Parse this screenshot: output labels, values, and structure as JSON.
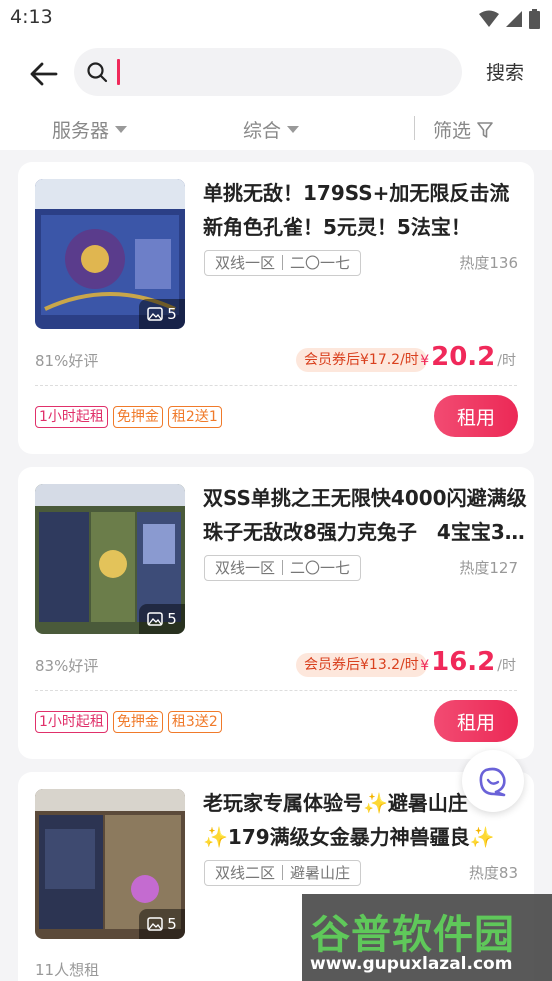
{
  "status": {
    "time": "4:13"
  },
  "search": {
    "placeholder": "",
    "button": "搜索"
  },
  "filters": [
    {
      "label": "服务器"
    },
    {
      "label": "综合"
    },
    {
      "label": "筛选"
    }
  ],
  "listings": [
    {
      "title": "单挑无敌！179SS+加无限反击流新角色孔雀！5元灵！5法宝！",
      "server": "双线一区｜二〇一七",
      "heat": "热度136",
      "image_count": "5",
      "rating": "81%好评",
      "coupon": "会员券后¥17.2/时",
      "price_symbol": "¥",
      "price": "20.2",
      "price_unit": "/时",
      "tags": [
        "1小时起租",
        "免押金",
        "租2送1"
      ],
      "button": "租用"
    },
    {
      "title": "双SS单挑之王无限快4000闪避满级珠子无敌改8强力克兔子　4宝宝3…",
      "server": "双线一区｜二〇一七",
      "heat": "热度127",
      "image_count": "5",
      "rating": "83%好评",
      "coupon": "会员券后¥13.2/时",
      "price_symbol": "¥",
      "price": "16.2",
      "price_unit": "/时",
      "tags": [
        "1小时起租",
        "免押金",
        "租3送2"
      ],
      "button": "租用"
    },
    {
      "title": "老玩家专属体验号✨避暑山庄✨179满级女金暴力神兽疆良✨物…",
      "server": "双线二区｜避暑山庄",
      "heat": "热度83",
      "image_count": "5",
      "rating": "11人想租",
      "coupon": "",
      "price_symbol": "",
      "price": "",
      "price_unit": "",
      "tags": [],
      "button": ""
    }
  ],
  "watermark": {
    "title": "谷普软件园",
    "url": "www.gupuxlazal.com"
  },
  "colors": {
    "accent": "#f0295a",
    "coupon_bg": "#fde7dc",
    "tag_pink": "#e0306a",
    "tag_orange": "#f07a2a"
  }
}
